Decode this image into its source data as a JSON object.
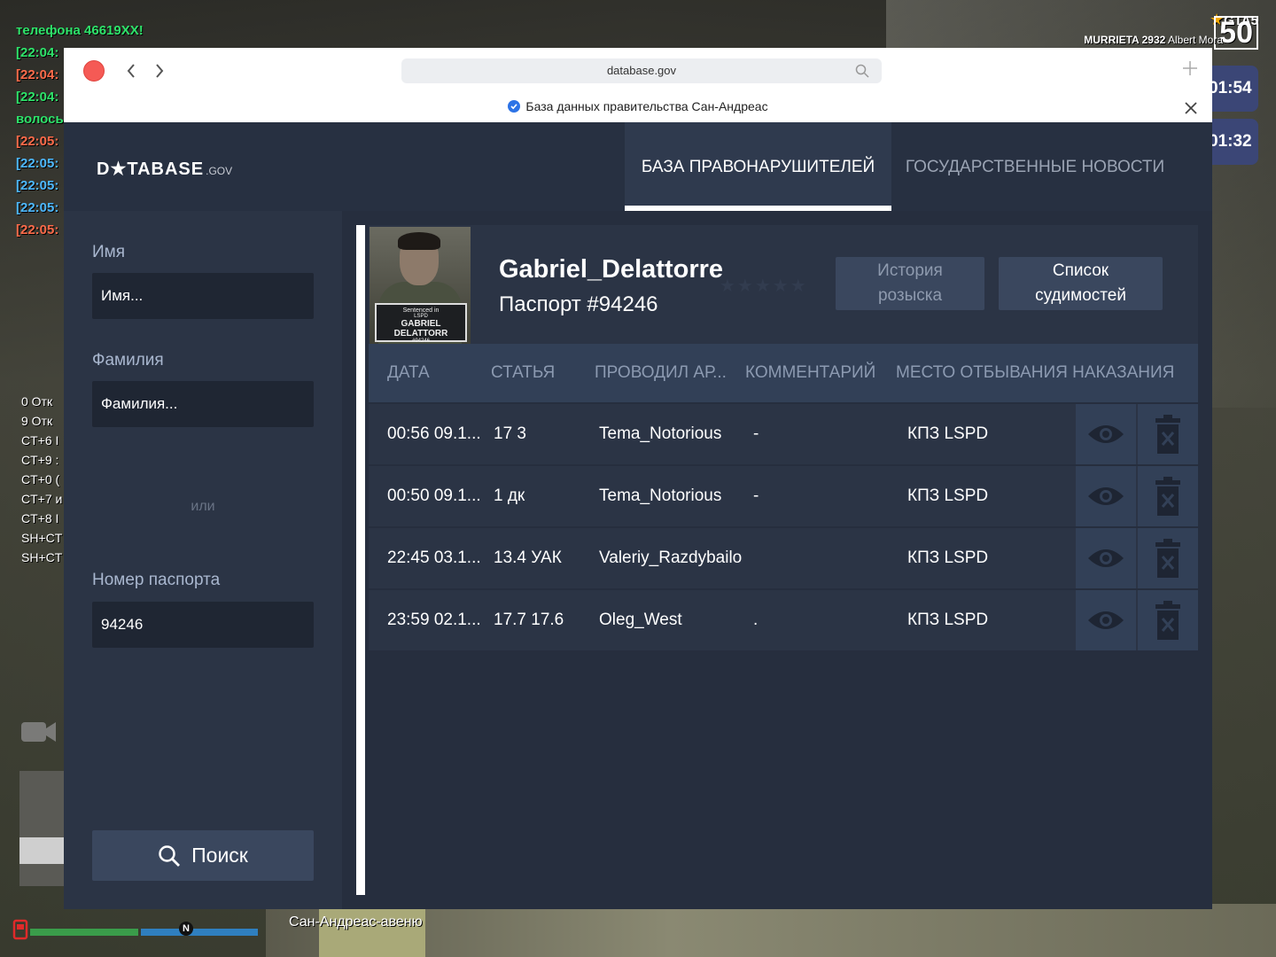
{
  "hud": {
    "chat": [
      {
        "text": "телефона 46619XX!",
        "color": "green"
      },
      {
        "text": "[22:04:",
        "color": "green"
      },
      {
        "text": "[22:04:",
        "color": "red"
      },
      {
        "text": "[22:04:",
        "color": "green"
      },
      {
        "text": "волось",
        "color": "green"
      },
      {
        "text": "[22:05:",
        "color": "red"
      },
      {
        "text": "[22:05:",
        "color": "blue"
      },
      {
        "text": "[22:05:",
        "color": "blue"
      },
      {
        "text": "[22:05:",
        "color": "blue"
      },
      {
        "text": "[22:05:",
        "color": "red"
      }
    ],
    "keys": [
      "0  Отк",
      "9  Отк",
      "CT+6  I",
      "CT+9  :",
      "CT+0  (",
      "CT+7  и",
      "CT+8  I",
      "SH+CT",
      "SH+CT"
    ],
    "brand": "GTA5",
    "brand_number": "50",
    "location_prefix": "MURRIETA 2932",
    "location_name": "Albert Mora",
    "timers": [
      "01:54",
      "01:32"
    ],
    "street": "Сан-Андреас-авеню",
    "compass": "N"
  },
  "browser": {
    "url": "database.gov",
    "info_text": "База данных правительства Сан-Андреас"
  },
  "app": {
    "logo_main": "D★TABASE",
    "logo_suffix": ".GOV",
    "tabs": [
      {
        "label": "БАЗА ПРАВОНАРУШИТЕЛЕЙ",
        "active": true
      },
      {
        "label": "ГОСУДАРСТВЕННЫЕ НОВОСТИ",
        "active": false
      }
    ],
    "sidebar": {
      "first_name_label": "Имя",
      "first_name_placeholder": "Имя...",
      "last_name_label": "Фамилия",
      "last_name_placeholder": "Фамилия...",
      "or_text": "или",
      "passport_label": "Номер паспорта",
      "passport_value": "94246",
      "search_label": "Поиск"
    },
    "profile": {
      "name": "Gabriel_Delattorre",
      "passport": "Паспорт #94246",
      "photo_plate": {
        "line1": "Sentenced in",
        "line2": "LSPD",
        "line3": "GABRIEL DELATTORR",
        "line4": "#94246"
      },
      "wanted_stars": "★★★★★",
      "wanted_history_btn": "История розыска",
      "convictions_btn": "Список судимостей"
    },
    "table": {
      "headers": [
        "ДАТА",
        "СТАТЬЯ",
        "ПРОВОДИЛ АР...",
        "КОММЕНТАРИЙ",
        "МЕСТО ОТБЫВАНИЯ НАКАЗАНИЯ"
      ],
      "rows": [
        {
          "date": "00:56 09.1...",
          "article": "17 3",
          "officer": "Tema_Notorious",
          "comment": "-",
          "place": "КПЗ LSPD"
        },
        {
          "date": "00:50 09.1...",
          "article": "1 дк",
          "officer": "Tema_Notorious",
          "comment": "-",
          "place": "КПЗ LSPD"
        },
        {
          "date": "22:45 03.1...",
          "article": "13.4 УАК",
          "officer": "Valeriy_Razdybailo",
          "comment": "",
          "place": "КПЗ LSPD"
        },
        {
          "date": "23:59 02.1...",
          "article": "17.7 17.6",
          "officer": "Oleg_West",
          "comment": ".",
          "place": "КПЗ LSPD"
        }
      ]
    }
  }
}
